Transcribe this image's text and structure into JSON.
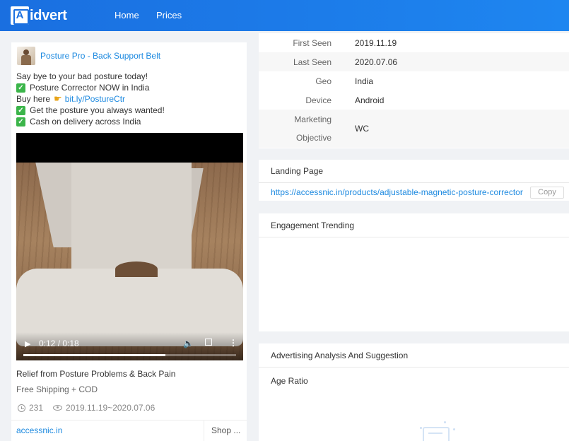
{
  "nav": {
    "logo_text": "idvert",
    "logo_mark": "A",
    "items": [
      "Home",
      "Prices"
    ]
  },
  "ad": {
    "page_name": "Posture Pro - Back Support Belt",
    "text_lines": [
      "Say bye to your bad posture today!",
      "Posture Corrector NOW in India",
      "Buy here",
      "Get the posture you always wanted!",
      "Cash on delivery across India"
    ],
    "link_text": "bit.ly/PostureCtr",
    "video": {
      "time_display": "0:12 / 0:18",
      "progress": 0.667
    },
    "headline": "Relief from Posture Problems & Back Pain",
    "subline": "Free Shipping + COD",
    "stats": {
      "days": "231",
      "date_range": "2019.11.19~2020.07.06"
    },
    "domain": "accessnic.in",
    "cta": "Shop ..."
  },
  "info": {
    "rows": [
      {
        "label": "First Seen",
        "value": "2019.11.19"
      },
      {
        "label": "Last Seen",
        "value": "2020.07.06"
      },
      {
        "label": "Geo",
        "value": "India"
      },
      {
        "label": "Device",
        "value": "Android"
      }
    ],
    "marketing": {
      "label_1": "Marketing",
      "label_2": "Objective",
      "value": "WC"
    }
  },
  "landing": {
    "title": "Landing Page",
    "url": "https://accessnic.in/products/adjustable-magnetic-posture-corrector",
    "copy_label": "Copy"
  },
  "engagement": {
    "title": "Engagement Trending"
  },
  "analysis": {
    "title": "Advertising Analysis And Suggestion",
    "age_label": "Age Ratio"
  },
  "colors": {
    "brand": "#1a6fe0",
    "link": "#1e8ae0",
    "check": "#3bb54a"
  }
}
